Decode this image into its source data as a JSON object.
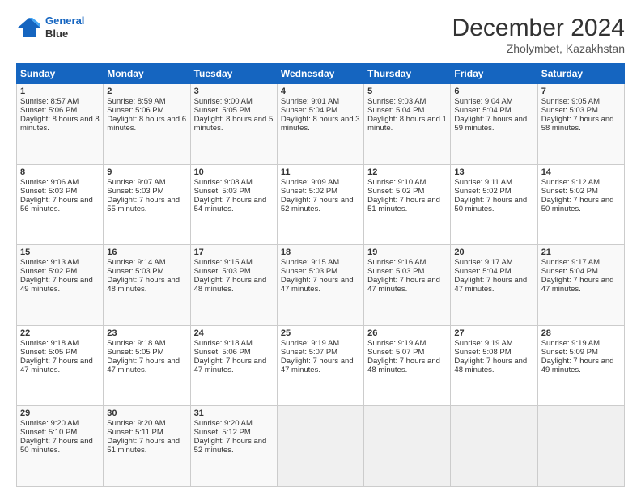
{
  "header": {
    "logo_line1": "General",
    "logo_line2": "Blue",
    "title": "December 2024",
    "subtitle": "Zholymbet, Kazakhstan"
  },
  "days": [
    "Sunday",
    "Monday",
    "Tuesday",
    "Wednesday",
    "Thursday",
    "Friday",
    "Saturday"
  ],
  "weeks": [
    [
      {
        "day": "1",
        "sunrise": "Sunrise: 8:57 AM",
        "sunset": "Sunset: 5:06 PM",
        "daylight": "Daylight: 8 hours and 8 minutes."
      },
      {
        "day": "2",
        "sunrise": "Sunrise: 8:59 AM",
        "sunset": "Sunset: 5:06 PM",
        "daylight": "Daylight: 8 hours and 6 minutes."
      },
      {
        "day": "3",
        "sunrise": "Sunrise: 9:00 AM",
        "sunset": "Sunset: 5:05 PM",
        "daylight": "Daylight: 8 hours and 5 minutes."
      },
      {
        "day": "4",
        "sunrise": "Sunrise: 9:01 AM",
        "sunset": "Sunset: 5:04 PM",
        "daylight": "Daylight: 8 hours and 3 minutes."
      },
      {
        "day": "5",
        "sunrise": "Sunrise: 9:03 AM",
        "sunset": "Sunset: 5:04 PM",
        "daylight": "Daylight: 8 hours and 1 minute."
      },
      {
        "day": "6",
        "sunrise": "Sunrise: 9:04 AM",
        "sunset": "Sunset: 5:04 PM",
        "daylight": "Daylight: 7 hours and 59 minutes."
      },
      {
        "day": "7",
        "sunrise": "Sunrise: 9:05 AM",
        "sunset": "Sunset: 5:03 PM",
        "daylight": "Daylight: 7 hours and 58 minutes."
      }
    ],
    [
      {
        "day": "8",
        "sunrise": "Sunrise: 9:06 AM",
        "sunset": "Sunset: 5:03 PM",
        "daylight": "Daylight: 7 hours and 56 minutes."
      },
      {
        "day": "9",
        "sunrise": "Sunrise: 9:07 AM",
        "sunset": "Sunset: 5:03 PM",
        "daylight": "Daylight: 7 hours and 55 minutes."
      },
      {
        "day": "10",
        "sunrise": "Sunrise: 9:08 AM",
        "sunset": "Sunset: 5:03 PM",
        "daylight": "Daylight: 7 hours and 54 minutes."
      },
      {
        "day": "11",
        "sunrise": "Sunrise: 9:09 AM",
        "sunset": "Sunset: 5:02 PM",
        "daylight": "Daylight: 7 hours and 52 minutes."
      },
      {
        "day": "12",
        "sunrise": "Sunrise: 9:10 AM",
        "sunset": "Sunset: 5:02 PM",
        "daylight": "Daylight: 7 hours and 51 minutes."
      },
      {
        "day": "13",
        "sunrise": "Sunrise: 9:11 AM",
        "sunset": "Sunset: 5:02 PM",
        "daylight": "Daylight: 7 hours and 50 minutes."
      },
      {
        "day": "14",
        "sunrise": "Sunrise: 9:12 AM",
        "sunset": "Sunset: 5:02 PM",
        "daylight": "Daylight: 7 hours and 50 minutes."
      }
    ],
    [
      {
        "day": "15",
        "sunrise": "Sunrise: 9:13 AM",
        "sunset": "Sunset: 5:02 PM",
        "daylight": "Daylight: 7 hours and 49 minutes."
      },
      {
        "day": "16",
        "sunrise": "Sunrise: 9:14 AM",
        "sunset": "Sunset: 5:03 PM",
        "daylight": "Daylight: 7 hours and 48 minutes."
      },
      {
        "day": "17",
        "sunrise": "Sunrise: 9:15 AM",
        "sunset": "Sunset: 5:03 PM",
        "daylight": "Daylight: 7 hours and 48 minutes."
      },
      {
        "day": "18",
        "sunrise": "Sunrise: 9:15 AM",
        "sunset": "Sunset: 5:03 PM",
        "daylight": "Daylight: 7 hours and 47 minutes."
      },
      {
        "day": "19",
        "sunrise": "Sunrise: 9:16 AM",
        "sunset": "Sunset: 5:03 PM",
        "daylight": "Daylight: 7 hours and 47 minutes."
      },
      {
        "day": "20",
        "sunrise": "Sunrise: 9:17 AM",
        "sunset": "Sunset: 5:04 PM",
        "daylight": "Daylight: 7 hours and 47 minutes."
      },
      {
        "day": "21",
        "sunrise": "Sunrise: 9:17 AM",
        "sunset": "Sunset: 5:04 PM",
        "daylight": "Daylight: 7 hours and 47 minutes."
      }
    ],
    [
      {
        "day": "22",
        "sunrise": "Sunrise: 9:18 AM",
        "sunset": "Sunset: 5:05 PM",
        "daylight": "Daylight: 7 hours and 47 minutes."
      },
      {
        "day": "23",
        "sunrise": "Sunrise: 9:18 AM",
        "sunset": "Sunset: 5:05 PM",
        "daylight": "Daylight: 7 hours and 47 minutes."
      },
      {
        "day": "24",
        "sunrise": "Sunrise: 9:18 AM",
        "sunset": "Sunset: 5:06 PM",
        "daylight": "Daylight: 7 hours and 47 minutes."
      },
      {
        "day": "25",
        "sunrise": "Sunrise: 9:19 AM",
        "sunset": "Sunset: 5:07 PM",
        "daylight": "Daylight: 7 hours and 47 minutes."
      },
      {
        "day": "26",
        "sunrise": "Sunrise: 9:19 AM",
        "sunset": "Sunset: 5:07 PM",
        "daylight": "Daylight: 7 hours and 48 minutes."
      },
      {
        "day": "27",
        "sunrise": "Sunrise: 9:19 AM",
        "sunset": "Sunset: 5:08 PM",
        "daylight": "Daylight: 7 hours and 48 minutes."
      },
      {
        "day": "28",
        "sunrise": "Sunrise: 9:19 AM",
        "sunset": "Sunset: 5:09 PM",
        "daylight": "Daylight: 7 hours and 49 minutes."
      }
    ],
    [
      {
        "day": "29",
        "sunrise": "Sunrise: 9:20 AM",
        "sunset": "Sunset: 5:10 PM",
        "daylight": "Daylight: 7 hours and 50 minutes."
      },
      {
        "day": "30",
        "sunrise": "Sunrise: 9:20 AM",
        "sunset": "Sunset: 5:11 PM",
        "daylight": "Daylight: 7 hours and 51 minutes."
      },
      {
        "day": "31",
        "sunrise": "Sunrise: 9:20 AM",
        "sunset": "Sunset: 5:12 PM",
        "daylight": "Daylight: 7 hours and 52 minutes."
      },
      null,
      null,
      null,
      null
    ]
  ]
}
